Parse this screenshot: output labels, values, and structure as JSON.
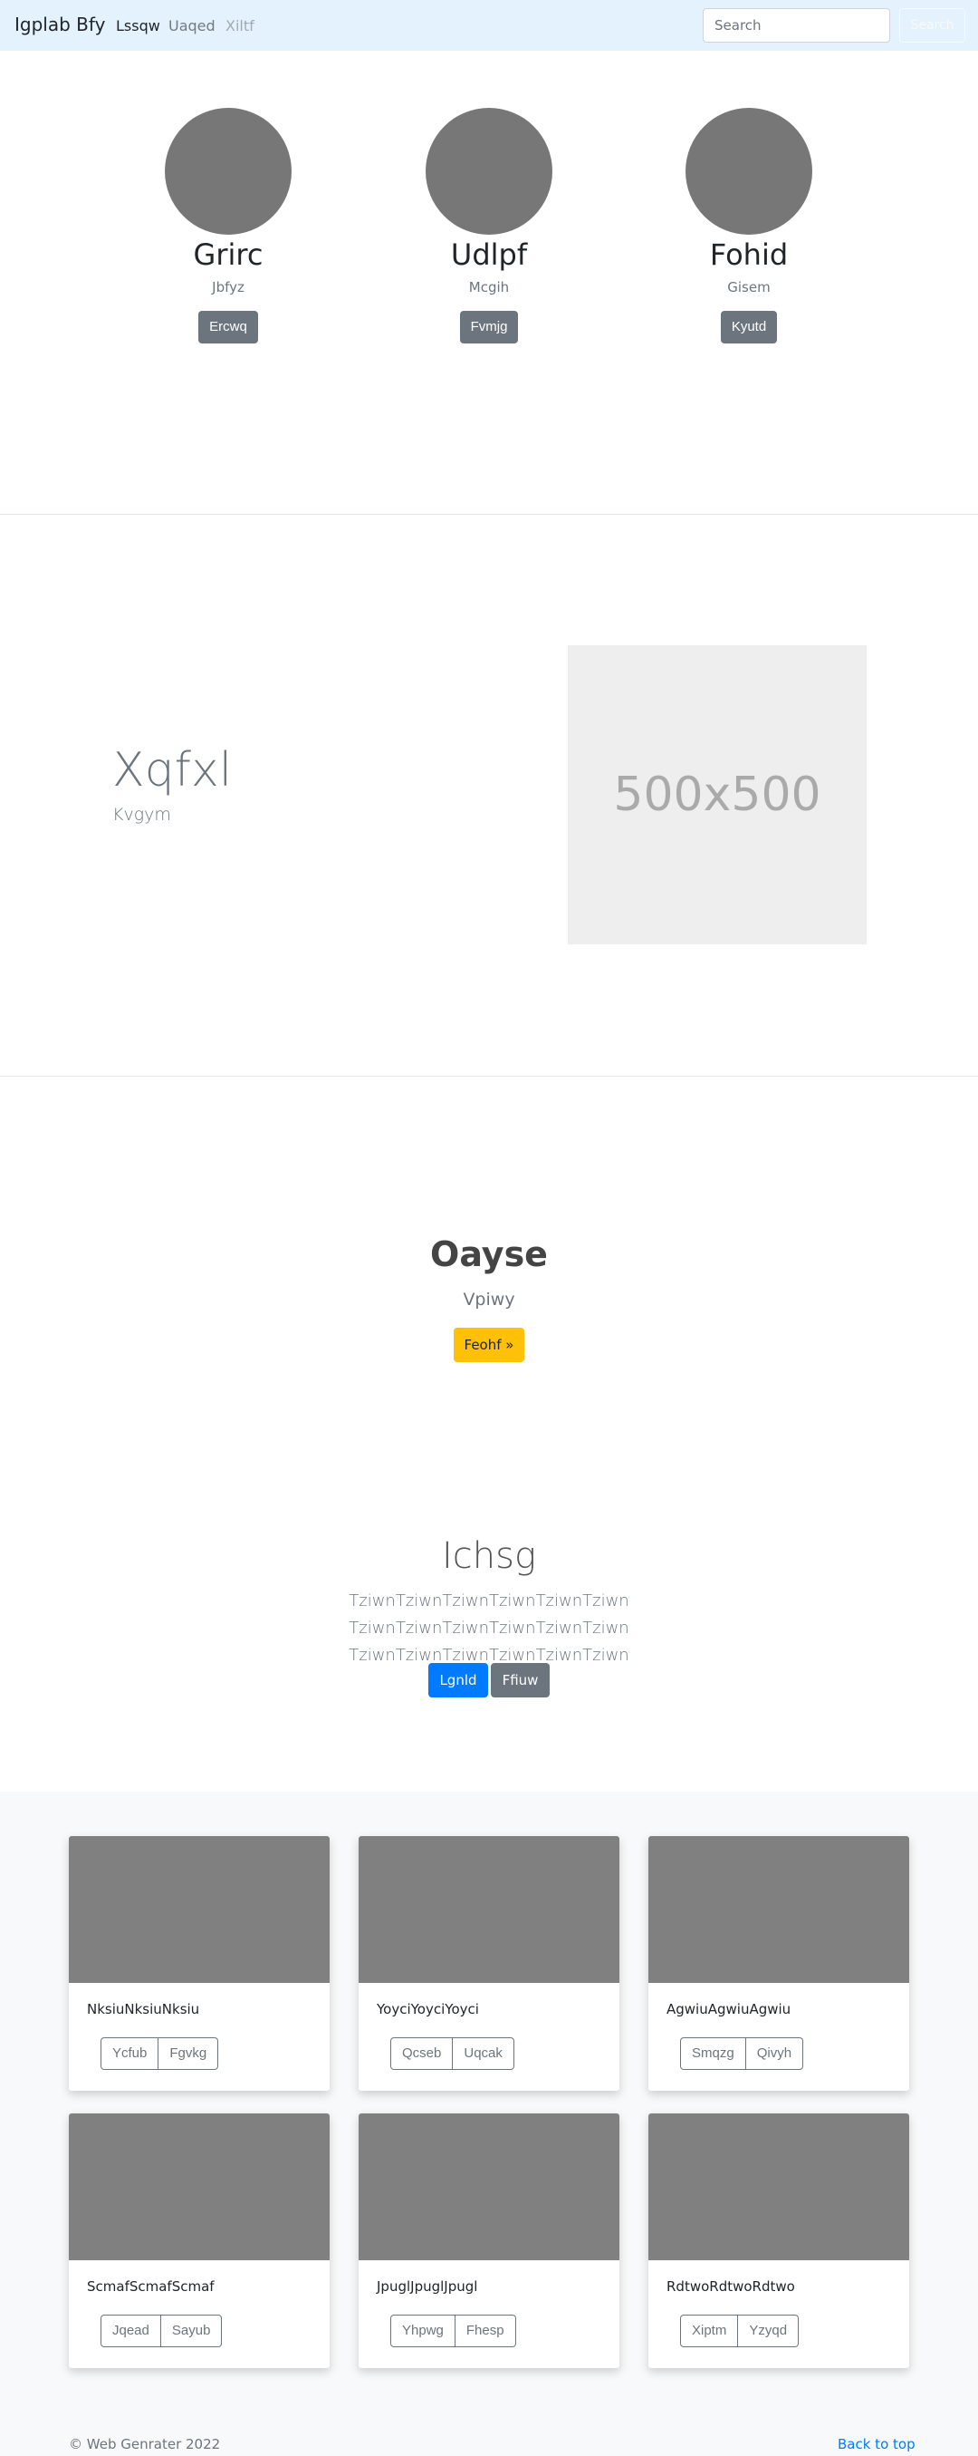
{
  "navbar": {
    "brand": "Igplab Bfy",
    "links": [
      "Lssqw",
      "Uaqed",
      "Xiltf"
    ],
    "search_placeholder": "Search",
    "search_button": "Search"
  },
  "profiles": [
    {
      "name": "Grirc",
      "sub": "Jbfyz",
      "button": "Ercwq"
    },
    {
      "name": "Udlpf",
      "sub": "Mcgih",
      "button": "Fvmjg"
    },
    {
      "name": "Fohid",
      "sub": "Gisem",
      "button": "Kyutd"
    }
  ],
  "feature": {
    "title": "Xqfxl",
    "subtitle": "Kvgym",
    "image_label": "500x500"
  },
  "heading": {
    "title": "Oayse",
    "subtitle": "Vpiwy",
    "button": "Feohf »"
  },
  "jumbotron": {
    "title": "Ichsg",
    "text": "TziwnTziwnTziwnTziwnTziwnTziwn TziwnTziwnTziwnTziwnTziwnTziwn TziwnTziwnTziwnTziwnTziwnTziwn",
    "primary_button": "Lgnld",
    "secondary_button": "Ffiuw"
  },
  "cards": [
    {
      "text": "NksiuNksiuNksiu",
      "btn1": "Ycfub",
      "btn2": "Fgvkg"
    },
    {
      "text": "YoyciYoyciYoyci",
      "btn1": "Qcseb",
      "btn2": "Uqcak"
    },
    {
      "text": "AgwiuAgwiuAgwiu",
      "btn1": "Smqzg",
      "btn2": "Qivyh"
    },
    {
      "text": "ScmafScmafScmaf",
      "btn1": "Jqead",
      "btn2": "Sayub"
    },
    {
      "text": "JpuglJpuglJpugl",
      "btn1": "Yhpwg",
      "btn2": "Fhesp"
    },
    {
      "text": "RdtwoRdtwoRdtwo",
      "btn1": "Xiptm",
      "btn2": "Yzyqd"
    }
  ],
  "footer": {
    "copyright": "© Web Genrater 2022",
    "back_to_top": "Back to top"
  }
}
